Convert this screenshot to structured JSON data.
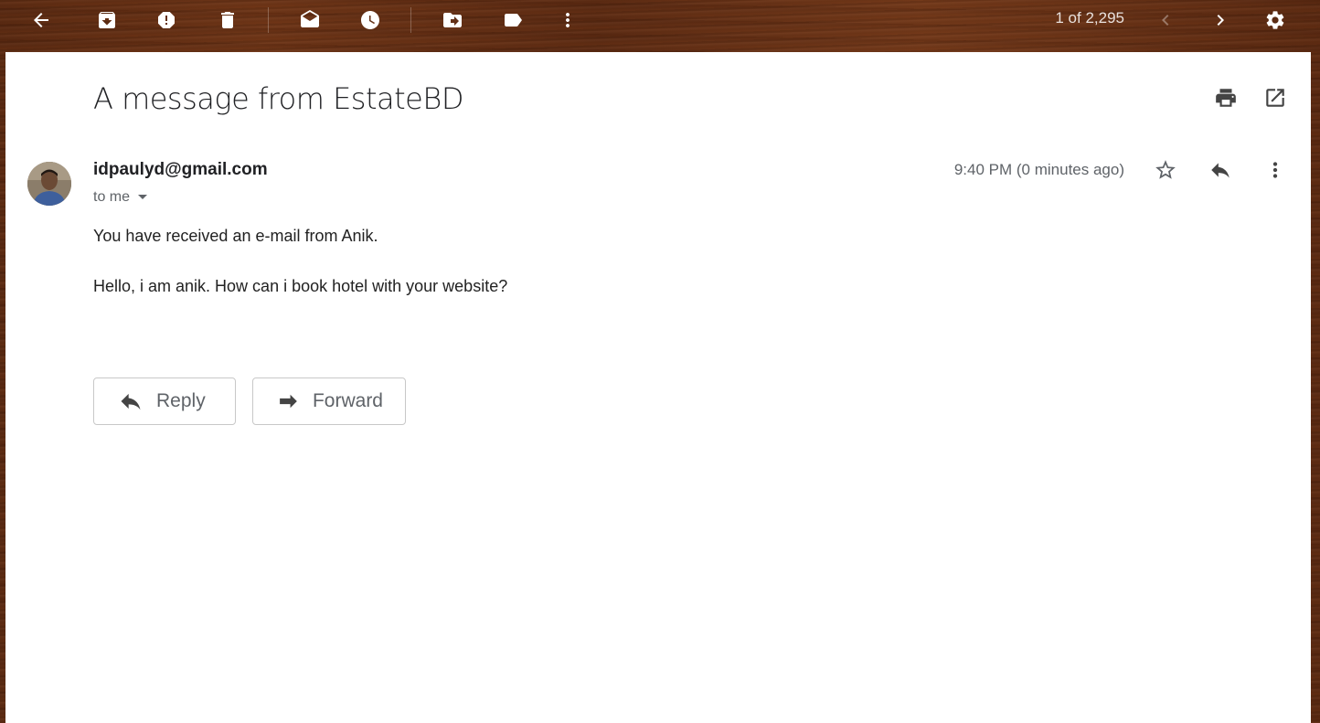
{
  "toolbar": {
    "icons": [
      "back-arrow-icon",
      "archive-icon",
      "report-spam-icon",
      "delete-icon",
      "mark-unread-icon",
      "snooze-icon",
      "move-to-icon",
      "labels-icon",
      "more-vert-icon"
    ],
    "counter": "1 of 2,295",
    "icon_color": "#ffffff"
  },
  "email": {
    "subject": "A message from EstateBD",
    "sender": "idpaulyd@gmail.com",
    "recipient": "to me",
    "time": "9:40 PM (0 minutes ago)",
    "body": [
      "You have received an e-mail from Anik.",
      "Hello, i am anik. How can i book hotel with your website?"
    ]
  },
  "actions": {
    "reply_label": "Reply",
    "forward_label": "Forward"
  },
  "colors": {
    "panel": "#ffffff",
    "text_primary": "#202124",
    "text_secondary": "#5f6368"
  }
}
